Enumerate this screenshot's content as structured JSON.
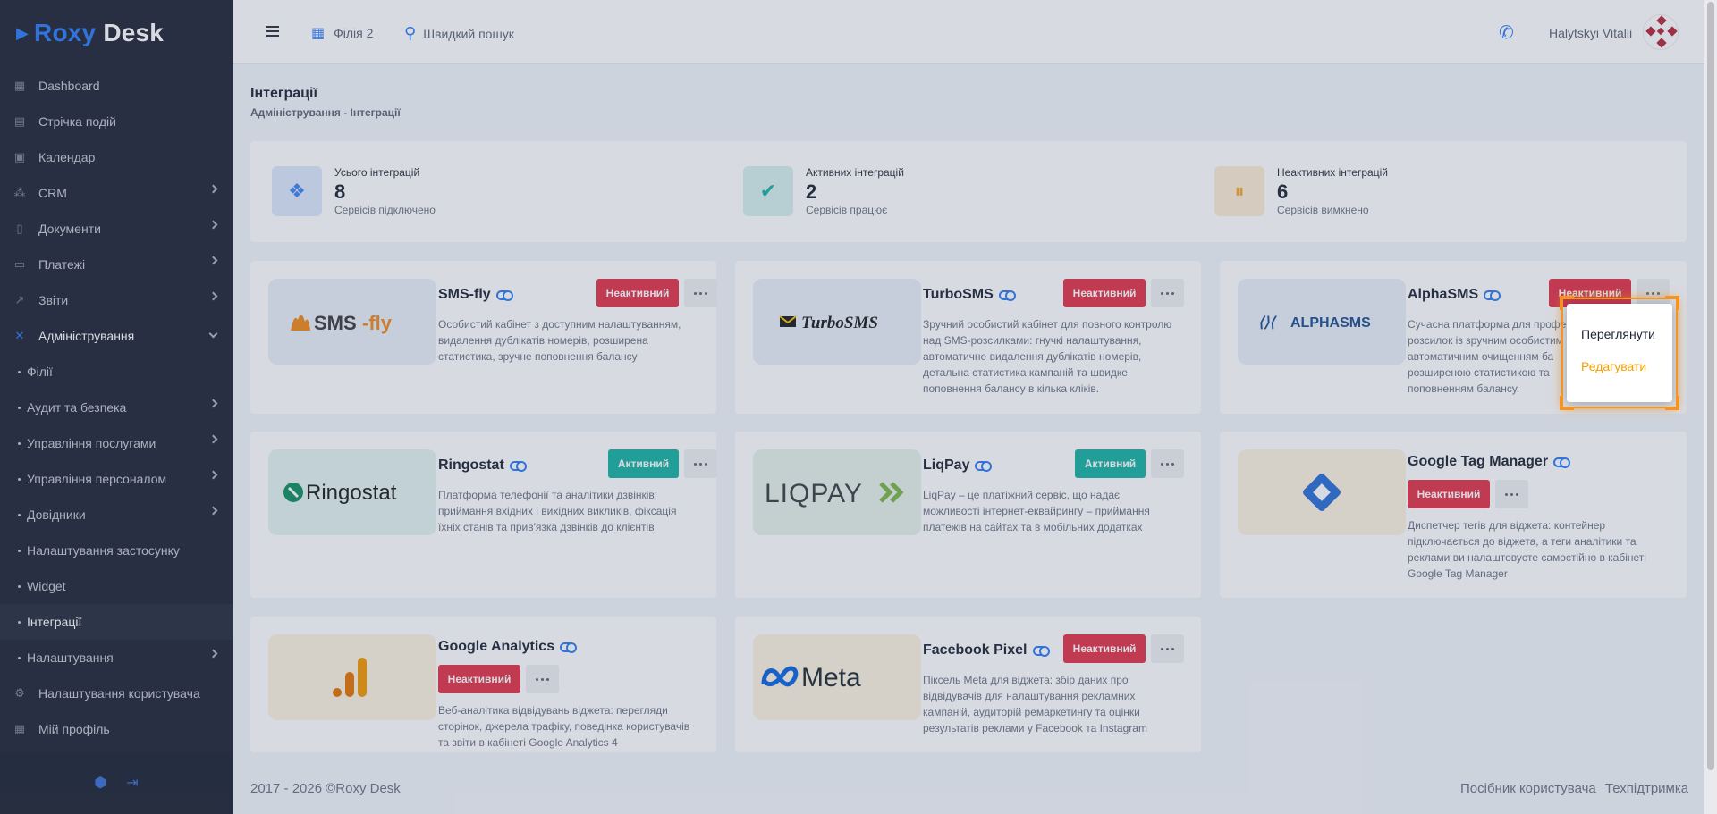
{
  "app": {
    "logo_roxy": "Roxy",
    "logo_desk": "Desk"
  },
  "sidebar": {
    "items": [
      {
        "label": "Dashboard",
        "icon": "dashboard-icon"
      },
      {
        "label": "Стрічка подій",
        "icon": "feed-icon"
      },
      {
        "label": "Календар",
        "icon": "calendar-icon"
      },
      {
        "label": "CRM",
        "icon": "crm-icon"
      },
      {
        "label": "Документи",
        "icon": "document-icon"
      },
      {
        "label": "Платежі",
        "icon": "payments-icon"
      },
      {
        "label": "Звіти",
        "icon": "reports-icon"
      },
      {
        "label": "Адміністрування",
        "icon": "tools-icon"
      },
      {
        "label": "Філії"
      },
      {
        "label": "Аудит та безпека"
      },
      {
        "label": "Управління послугами"
      },
      {
        "label": "Управління персоналом"
      },
      {
        "label": "Довідники"
      },
      {
        "label": "Налаштування застосунку"
      },
      {
        "label": "Widget"
      },
      {
        "label": "Інтеграції"
      },
      {
        "label": "Налаштування"
      },
      {
        "label": "Налаштування користувача",
        "icon": "user-settings-icon"
      },
      {
        "label": "Мій профіль",
        "icon": "profile-icon"
      }
    ]
  },
  "header": {
    "branch": "Філія 2",
    "quick_search": "Швидкий пошук",
    "user_name": "Halytskyi Vitalii"
  },
  "page": {
    "title": "Інтеграції",
    "breadcrumb": "Адміністрування - Інтеграції"
  },
  "stats": [
    {
      "label": "Усього інтеграцій",
      "value": "8",
      "sub": "Сервісів підключено",
      "color": "#3b82f6"
    },
    {
      "label": "Активних інтеграцій",
      "value": "2",
      "sub": "Сервісів працює",
      "color": "#17b3a3"
    },
    {
      "label": "Неактивних інтеграцій",
      "value": "6",
      "sub": "Сервісів вимкнено",
      "color": "#f5a623"
    }
  ],
  "cards": [
    {
      "name": "SMS-fly",
      "status": "Неактивний",
      "logo_text": "SMS-fly",
      "desc": [
        "Особистий кабінет з доступним налаштуванням,",
        "видалення дублікатів номерів, розширена",
        "статистика, зручне поповнення балансу"
      ]
    },
    {
      "name": "TurboSMS",
      "status": "Неактивний",
      "logo_text": "TurboSMS",
      "desc": [
        "Зручний особистий кабінет для повного контролю",
        "над SMS-розсилками: гнучкі налаштування,",
        "автоматичне видалення дублікатів номерів,",
        "детальна статистика кампаній та швидке",
        "поповнення балансу в кілька кліків."
      ]
    },
    {
      "name": "AlphaSMS",
      "status": "Неактивний",
      "logo_text": "ALPHASMS",
      "desc": [
        "Сучасна платформа для профе",
        "розсилок із зручним особистим",
        "автоматичним очищенням ба",
        "розширеною статистикою та",
        "поповненням балансу."
      ]
    },
    {
      "name": "Ringostat",
      "status": "Активний",
      "logo_text": "Ringostat",
      "desc": [
        "Платформа телефонії та аналітики дзвінків:",
        "приймання вхідних і вихідних викликів, фіксація",
        "їхніх станів та прив'язка дзвінків до клієнтів"
      ]
    },
    {
      "name": "LiqPay",
      "status": "Активний",
      "logo_text": "LIQPAY",
      "desc": [
        "LiqPay – це платіжний сервіс, що надає",
        "можливості інтернет-еквайрингу – приймання",
        "платежів на сайтах та в мобільних додатках"
      ]
    },
    {
      "name": "Google Tag Manager",
      "status": "Неактивний",
      "desc": [
        "Диспетчер тегів для віджета: контейнер",
        "підключається до віджета, а теги аналітики та",
        "реклами ви налаштовуєте самостійно в кабінеті",
        "Google Tag Manager"
      ]
    },
    {
      "name": "Google Analytics",
      "status": "Неактивний",
      "desc": [
        "Веб-аналітика відвідувань віджета: перегляди",
        "сторінок, джерела трафіку, поведінка користувачів",
        "та звіти в кабінеті Google Analytics 4"
      ]
    },
    {
      "name": "Facebook Pixel",
      "status": "Неактивний",
      "logo_text": "Meta",
      "desc": [
        "Піксель Meta для віджета: збір даних про",
        "відвідувачів для налаштування рекламних",
        "кампаній, аудиторій ремаркетингу та оцінки",
        "результатів реклами у Facebook та Instagram"
      ]
    }
  ],
  "dropdown": {
    "view": "Переглянути",
    "edit": "Редагувати"
  },
  "footer": {
    "copyright": "2017 - 2026 ©Roxy Desk",
    "guide": "Посібник користувача",
    "support": "Техпідтримка"
  },
  "colors": {
    "accent": "#2b7cf6",
    "inactive": "#e2324a",
    "active": "#17b3a3",
    "sidebar": "#1f2535"
  }
}
